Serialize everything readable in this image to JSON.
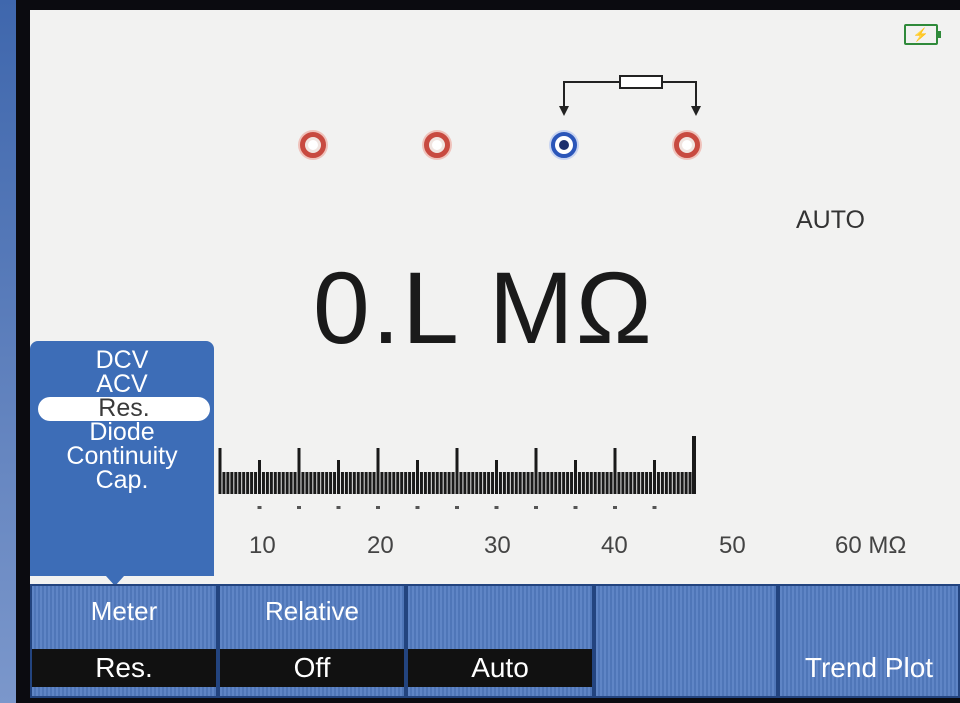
{
  "status": {
    "battery_icon": "battery-charging-icon",
    "battery_glyph": "⚡"
  },
  "range_mode": "AUTO",
  "reading": {
    "value": "0.L",
    "unit": "MΩ"
  },
  "function_menu": {
    "items": [
      "DCV",
      "ACV",
      "Res.",
      "Diode",
      "Continuity",
      "Cap."
    ],
    "selected": "Res."
  },
  "scale": {
    "labels": [
      "10",
      "20",
      "30",
      "40",
      "50",
      "60 MΩ"
    ],
    "min": 0,
    "max": 60,
    "unit": "MΩ"
  },
  "softkeys": [
    {
      "label": "Meter",
      "value": "Res."
    },
    {
      "label": "Relative",
      "value": "Off"
    },
    {
      "label": "",
      "value": "Auto"
    },
    {
      "label": "",
      "value": ""
    },
    {
      "label": "",
      "value": "Trend Plot"
    }
  ],
  "colors": {
    "menu_blue": "#3d6db7",
    "jack_red": "#c84a40",
    "jack_blue": "#2b56b9",
    "battery_green": "#2f8a3a"
  }
}
